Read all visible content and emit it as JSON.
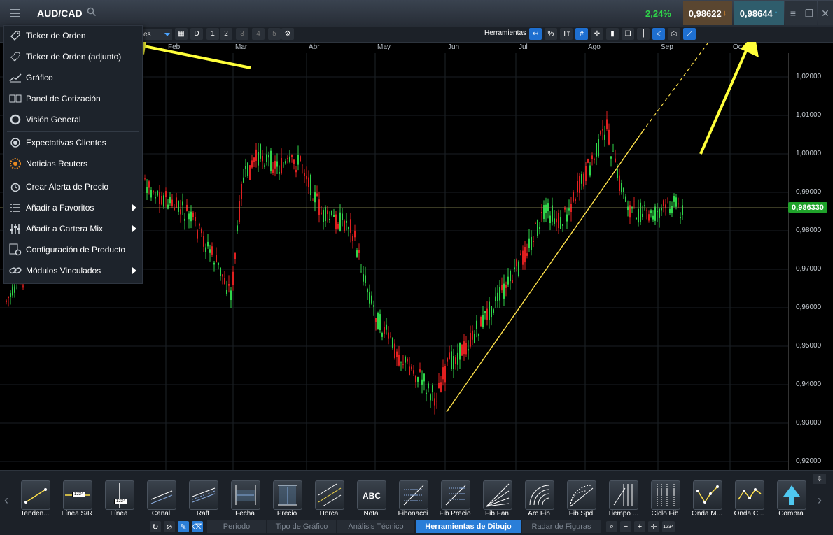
{
  "header": {
    "symbol": "AUD/CAD",
    "change_pct": "2,24%",
    "sell_price": "0,98622",
    "buy_price": "0,98644"
  },
  "toolbar": {
    "period_partial": "ses",
    "buttons": [
      "D",
      "1",
      "2",
      "3",
      "4",
      "5"
    ],
    "herramientas_label": "Herramientas",
    "percent_label": "%",
    "text_label": "Tт"
  },
  "months": [
    "Feb",
    "Mar",
    "Abr",
    "May",
    "Jun",
    "Jul",
    "Ago",
    "Sep",
    "Oc"
  ],
  "y_axis_ticks": [
    "1,02000",
    "1,01000",
    "1,00000",
    "0,99000",
    "0,98000",
    "0,97000",
    "0,96000",
    "0,95000",
    "0,94000",
    "0,93000",
    "0,92000"
  ],
  "current_price_label": "0,986330",
  "menu": {
    "items": [
      {
        "label": "Ticker de Orden",
        "icon": "tag-icon",
        "has_submenu": false
      },
      {
        "label": "Ticker de Orden (adjunto)",
        "icon": "tag-attached-icon",
        "has_submenu": false
      },
      {
        "label": "Gráfico",
        "icon": "line-chart-icon",
        "has_submenu": false
      },
      {
        "label": "Panel de Cotización",
        "icon": "quote-panel-icon",
        "has_submenu": false
      },
      {
        "label": "Visión General",
        "icon": "overview-icon",
        "has_submenu": false
      },
      {
        "label": "Expectativas Clientes",
        "icon": "client-sentiment-icon",
        "has_submenu": false
      },
      {
        "label": "Noticias Reuters",
        "icon": "reuters-icon",
        "has_submenu": false
      },
      {
        "label": "Crear Alerta de Precio",
        "icon": "alarm-clock-icon",
        "has_submenu": false
      },
      {
        "label": "Añadir a Favoritos",
        "icon": "list-icon",
        "has_submenu": true
      },
      {
        "label": "Añadir a Cartera Mix",
        "icon": "sliders-icon",
        "has_submenu": true
      },
      {
        "label": "Configuración de Producto",
        "icon": "settings-doc-icon",
        "has_submenu": false
      },
      {
        "label": "Módulos Vinculados",
        "icon": "link-icon",
        "has_submenu": true
      }
    ]
  },
  "drawing_tools": [
    {
      "label": "Tenden...",
      "icon": "trendline-icon"
    },
    {
      "label": "Línea S/R",
      "icon": "sr-line-icon",
      "badge": "1234"
    },
    {
      "label": "Línea",
      "icon": "vertical-line-icon",
      "badge": "1234"
    },
    {
      "label": "Canal",
      "icon": "channel-icon"
    },
    {
      "label": "Raff",
      "icon": "raff-icon"
    },
    {
      "label": "Fecha",
      "icon": "date-range-icon"
    },
    {
      "label": "Precio",
      "icon": "price-range-icon"
    },
    {
      "label": "Horca",
      "icon": "pitchfork-icon"
    },
    {
      "label": "Nota",
      "icon": "note-icon",
      "badge": "ABC"
    },
    {
      "label": "Fibonacci",
      "icon": "fibonacci-icon"
    },
    {
      "label": "Fib Precio",
      "icon": "fib-price-icon"
    },
    {
      "label": "Fib Fan",
      "icon": "fib-fan-icon"
    },
    {
      "label": "Arc Fib",
      "icon": "fib-arc-icon"
    },
    {
      "label": "Fib Spd",
      "icon": "fib-speed-icon"
    },
    {
      "label": "Tiempo ...",
      "icon": "fib-time-icon"
    },
    {
      "label": "Ciclo Fib",
      "icon": "fib-cycle-icon"
    },
    {
      "label": "Onda M...",
      "icon": "wave-m-icon"
    },
    {
      "label": "Onda C...",
      "icon": "wave-c-icon"
    },
    {
      "label": "Compra",
      "icon": "buy-arrow-icon"
    }
  ],
  "bottom_tabs": [
    {
      "label": "Período",
      "active": false
    },
    {
      "label": "Tipo de Gráfico",
      "active": false
    },
    {
      "label": "Análisis Técnico",
      "active": false
    },
    {
      "label": "Herramientas de Dibujo",
      "active": true
    },
    {
      "label": "Radar de Figuras",
      "active": false
    }
  ],
  "bottom_badge": "1234",
  "colors": {
    "bull": "#2fd64a",
    "bear": "#e02020",
    "trendline": "#ffe14a",
    "accent": "#2a7ed8"
  }
}
